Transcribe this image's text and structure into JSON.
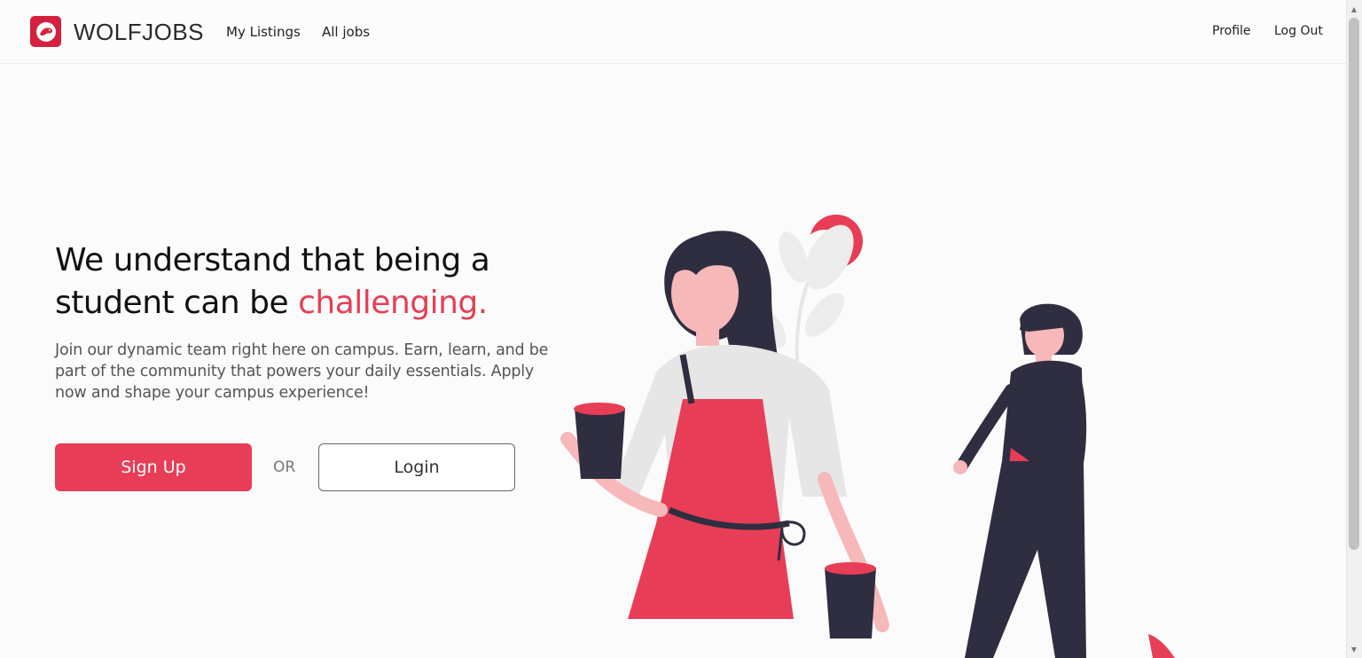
{
  "navbar": {
    "brand": "WOLFJOBS",
    "links": [
      {
        "label": "My Listings"
      },
      {
        "label": "All jobs"
      }
    ],
    "right_links": [
      {
        "label": "Profile"
      },
      {
        "label": "Log Out"
      }
    ]
  },
  "hero": {
    "headline_part1": "We understand that being a",
    "headline_part2": "student can be ",
    "headline_accent": "challenging.",
    "subtext": "Join our dynamic team right here on campus. Earn, learn, and be part of the community that powers your daily essentials. Apply now and shape your campus experience!",
    "signup_label": "Sign Up",
    "or_label": "OR",
    "login_label": "Login"
  },
  "colors": {
    "accent": "#e83d56",
    "dark": "#2f2e41",
    "brand_red": "#d4213d"
  }
}
